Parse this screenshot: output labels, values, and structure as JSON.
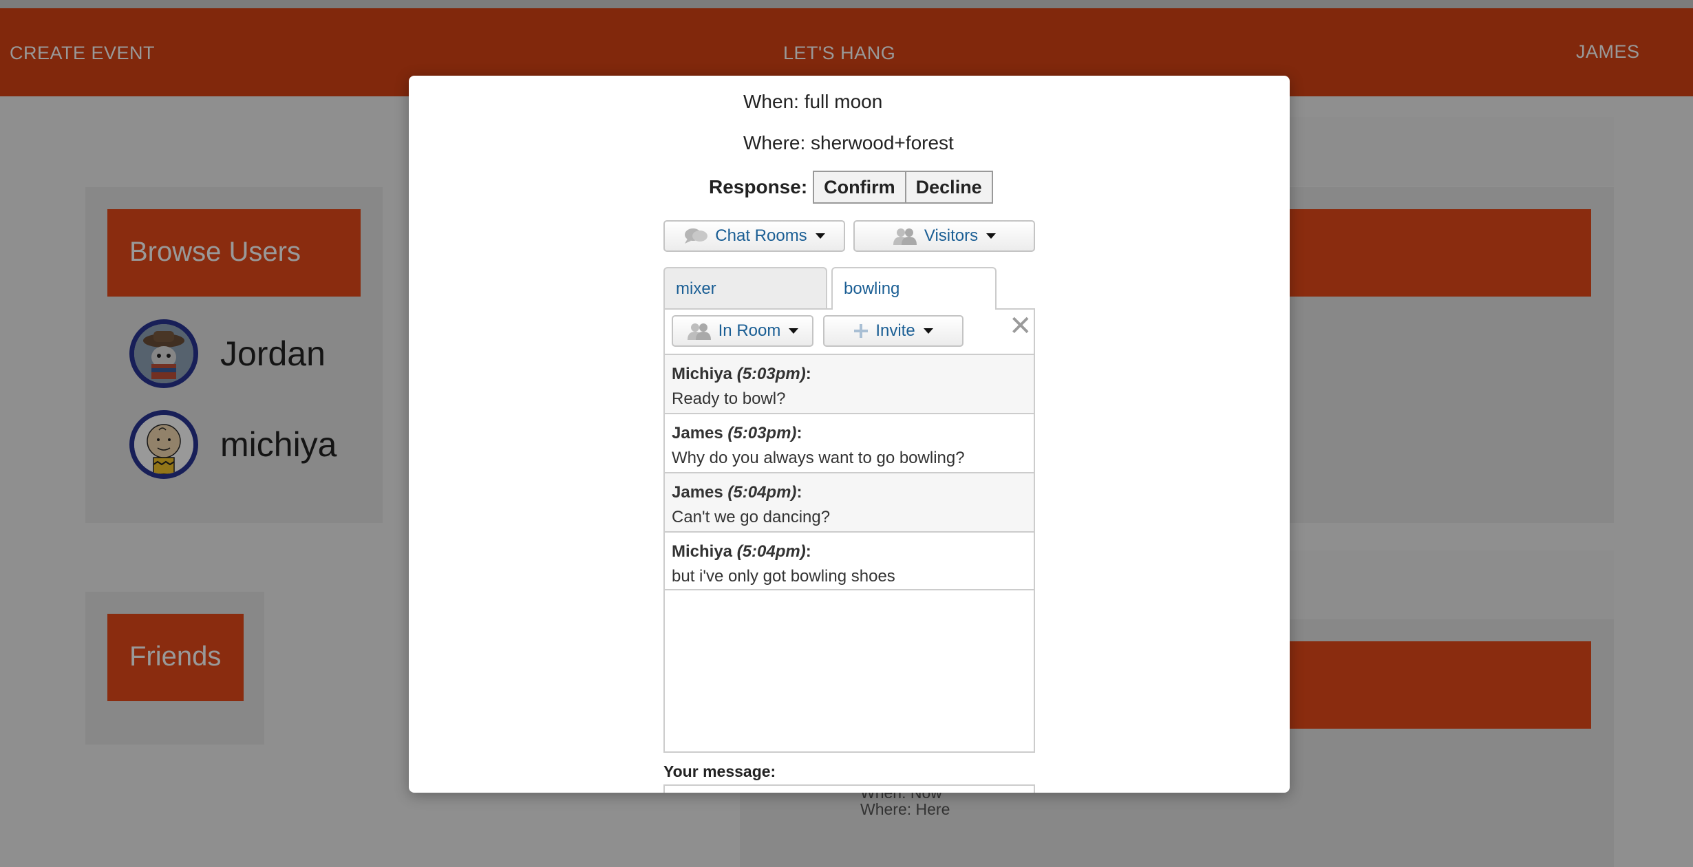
{
  "nav": {
    "create_event": "CREATE EVENT",
    "brand": "LET'S HANG",
    "user": "JAMES"
  },
  "browse": {
    "title": "Browse Users",
    "users": [
      {
        "name": "Jordan",
        "avatar": "sombrero-dog-avatar"
      },
      {
        "name": "michiya",
        "avatar": "charlie-brown-avatar"
      }
    ]
  },
  "friends": {
    "title": "Friends"
  },
  "background_event": {
    "when": "When: Now",
    "where": "Where: Here"
  },
  "modal": {
    "when": "When: full moon",
    "where": "Where: sherwood+forest",
    "response_label": "Response:",
    "confirm_label": "Confirm",
    "decline_label": "Decline",
    "chat_rooms_label": "Chat Rooms",
    "visitors_label": "Visitors",
    "tabs": [
      {
        "label": "mixer",
        "active": false
      },
      {
        "label": "bowling",
        "active": true
      }
    ],
    "in_room_label": "In Room",
    "invite_label": "Invite",
    "close_glyph": "✕",
    "messages": [
      {
        "author": "Michiya",
        "time": "(5:03pm)",
        "text": "Ready to bowl?"
      },
      {
        "author": "James",
        "time": "(5:03pm)",
        "text": "Why do you always want to go bowling?"
      },
      {
        "author": "James",
        "time": "(5:04pm)",
        "text": "Can't we go dancing?"
      },
      {
        "author": "Michiya",
        "time": "(5:04pm)",
        "text": "but i've only got bowling shoes"
      }
    ],
    "your_message_label": "Your message:"
  },
  "colors": {
    "nav_bg": "#d84315",
    "accent": "#e64a19",
    "avatar_ring": "#283593",
    "link_blue": "#1a5e94"
  }
}
